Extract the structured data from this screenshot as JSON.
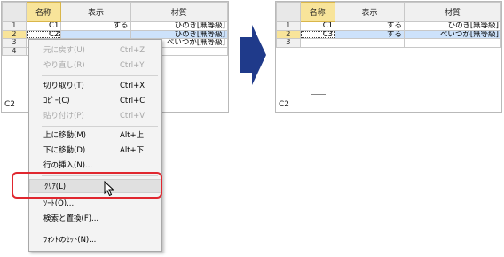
{
  "columns": [
    "名称",
    "表示",
    "材質"
  ],
  "status_cell": "C2",
  "before": {
    "rows": [
      {
        "num": "1",
        "name": "C1",
        "show": "する",
        "material": "ひのき[無等級]"
      },
      {
        "num": "2",
        "name": "C2",
        "show": "",
        "material": "ひのき[無等級]"
      },
      {
        "num": "3",
        "name": "",
        "show": "",
        "material": "べいつが[無等級]"
      },
      {
        "num": "4",
        "name": "",
        "show": "",
        "material": ""
      }
    ]
  },
  "after": {
    "rows": [
      {
        "num": "1",
        "name": "C1",
        "show": "する",
        "material": "ひのき[無等級]"
      },
      {
        "num": "2",
        "name": "C3",
        "show": "する",
        "material": "べいつが[無等級]"
      },
      {
        "num": "3",
        "name": "",
        "show": "",
        "material": ""
      }
    ]
  },
  "menu": {
    "undo": {
      "label": "元に戻す(U)",
      "shortcut": "Ctrl+Z"
    },
    "redo": {
      "label": "やり直し(R)",
      "shortcut": "Ctrl+Y"
    },
    "cut": {
      "label": "切り取り(T)",
      "shortcut": "Ctrl+X"
    },
    "copy": {
      "label": "ｺﾋﾟｰ(C)",
      "shortcut": "Ctrl+C"
    },
    "paste": {
      "label": "貼り付け(P)",
      "shortcut": "Ctrl+V"
    },
    "move_up": {
      "label": "上に移動(M)",
      "shortcut": "Alt+上"
    },
    "move_down": {
      "label": "下に移動(D)",
      "shortcut": "Alt+下"
    },
    "insert_row": {
      "label": "行の挿入(N)...",
      "shortcut": ""
    },
    "clear": {
      "label": "ｸﾘｱ(L)",
      "shortcut": ""
    },
    "sort": {
      "label": "ｿｰﾄ(O)...",
      "shortcut": ""
    },
    "find_replace": {
      "label": "検索と置換(F)...",
      "shortcut": ""
    },
    "font_set": {
      "label": "ﾌｫﾝﾄのｾｯﾄ(N)...",
      "shortcut": ""
    }
  },
  "colors": {
    "highlight": "#e0272f",
    "arrow": "#1f3a8a",
    "selected_header": "#f8e49a",
    "selected_row": "#cde2fb"
  }
}
